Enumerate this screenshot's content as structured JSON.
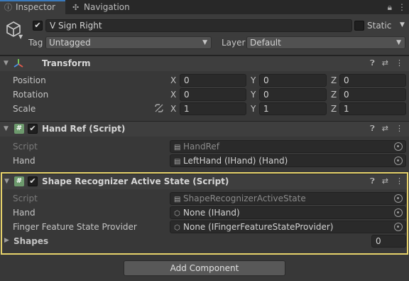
{
  "tabs": [
    {
      "label": "Inspector",
      "icon": "info-icon"
    },
    {
      "label": "Navigation",
      "icon": "navigation-icon"
    }
  ],
  "object": {
    "name": "V Sign Right",
    "active": true,
    "static_label": "Static",
    "tag_label": "Tag",
    "tag_value": "Untagged",
    "layer_label": "Layer",
    "layer_value": "Default"
  },
  "transform": {
    "title": "Transform",
    "position_label": "Position",
    "rotation_label": "Rotation",
    "scale_label": "Scale",
    "x": "X",
    "y": "Y",
    "z": "Z",
    "position": [
      "0",
      "0",
      "0"
    ],
    "rotation": [
      "0",
      "0",
      "0"
    ],
    "scale": [
      "1",
      "1",
      "1"
    ]
  },
  "handref": {
    "title": "Hand Ref (Script)",
    "script_label": "Script",
    "script_value": "HandRef",
    "hand_label": "Hand",
    "hand_value": "LeftHand (IHand) (Hand)"
  },
  "shape": {
    "title": "Shape Recognizer Active State (Script)",
    "script_label": "Script",
    "script_value": "ShapeRecognizerActiveState",
    "hand_label": "Hand",
    "hand_value": "None (IHand)",
    "finger_label": "Finger Feature State Provider",
    "finger_value": "None (IFingerFeatureStateProvider)",
    "shapes_label": "Shapes",
    "shapes_value": "0"
  },
  "add_component": "Add Component",
  "colors": {
    "highlight": "#e6d26b",
    "accent": "#3a79bb"
  }
}
